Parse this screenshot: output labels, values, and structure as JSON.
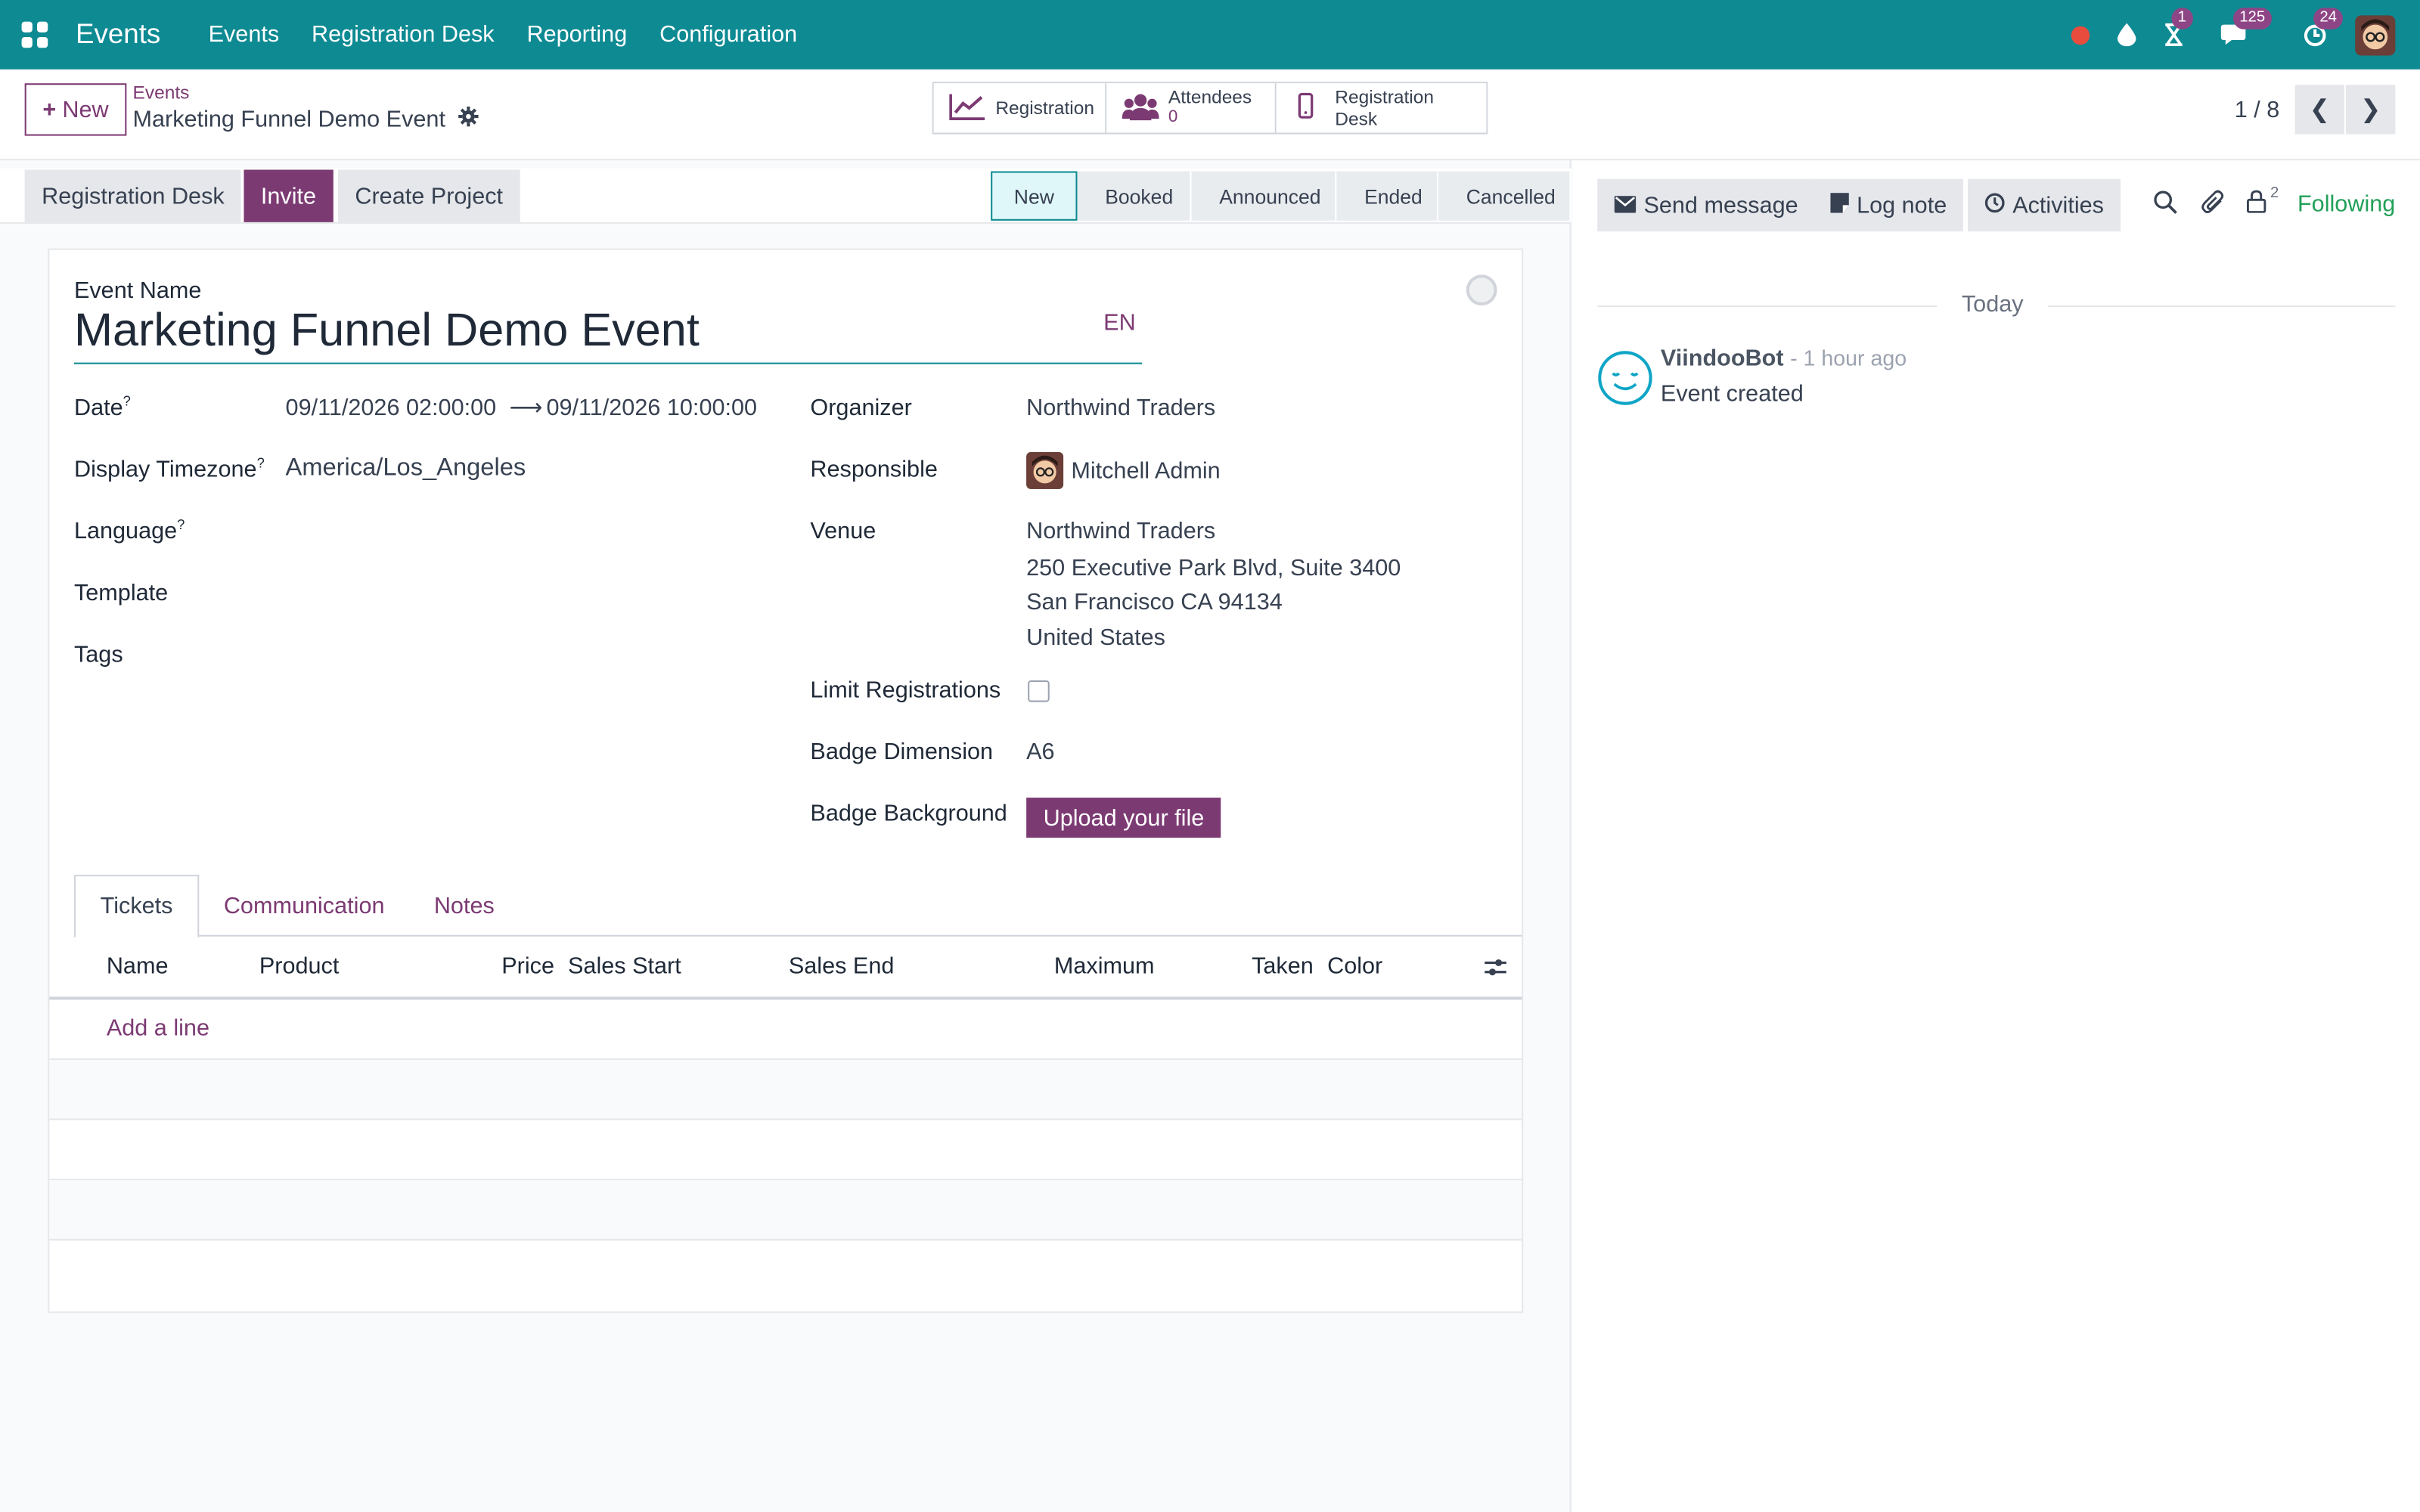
{
  "navbar": {
    "brand": "Events",
    "menu": [
      "Events",
      "Registration Desk",
      "Reporting",
      "Configuration"
    ],
    "badges": {
      "activities": "1",
      "messages": "125",
      "updates": "24"
    },
    "accent_color": "#0e8a93"
  },
  "control_panel": {
    "new_label": "New",
    "breadcrumb_parent": "Events",
    "breadcrumb_current": "Marketing Funnel Demo Event",
    "smart_buttons": {
      "registration": "Registration",
      "attendees_label": "Attendees",
      "attendees_value": "0",
      "registration_desk": "Registration Desk"
    },
    "pager": "1 / 8"
  },
  "statusbar": {
    "actions": [
      "Registration Desk",
      "Invite",
      "Create Project"
    ],
    "stages": [
      "New",
      "Booked",
      "Announced",
      "Ended",
      "Cancelled"
    ],
    "active_stage": "New"
  },
  "form": {
    "event_name_label": "Event Name",
    "event_name": "Marketing Funnel Demo Event",
    "lang": "EN",
    "date_label": "Date",
    "date_start": "09/11/2026 02:00:00",
    "date_end": "09/11/2026 10:00:00",
    "timezone_label": "Display Timezone",
    "timezone": "America/Los_Angeles",
    "language_label": "Language",
    "template_label": "Template",
    "tags_label": "Tags",
    "help_mark": "?",
    "organizer_label": "Organizer",
    "organizer": "Northwind Traders",
    "responsible_label": "Responsible",
    "responsible": "Mitchell Admin",
    "venue_label": "Venue",
    "venue_name": "Northwind Traders",
    "venue_street": "250 Executive Park Blvd, Suite 3400",
    "venue_city": "San Francisco CA 94134",
    "venue_country": "United States",
    "limit_label": "Limit Registrations",
    "limit_checked": false,
    "badge_dim_label": "Badge Dimension",
    "badge_dim": "A6",
    "badge_bg_label": "Badge Background",
    "upload_label": "Upload your file"
  },
  "tabs": {
    "items": [
      "Tickets",
      "Communication",
      "Notes"
    ],
    "active": "Tickets"
  },
  "tickets_table": {
    "columns": [
      "Name",
      "Product",
      "Price",
      "Sales Start",
      "Sales End",
      "Maximum",
      "Taken",
      "Color"
    ],
    "add_line": "Add a line"
  },
  "chatter": {
    "send_message": "Send message",
    "log_note": "Log note",
    "activities": "Activities",
    "followers_count": "2",
    "following": "Following",
    "date_separator": "Today",
    "messages": [
      {
        "author": "ViindooBot",
        "time": "- 1 hour ago",
        "body": "Event created"
      }
    ]
  }
}
